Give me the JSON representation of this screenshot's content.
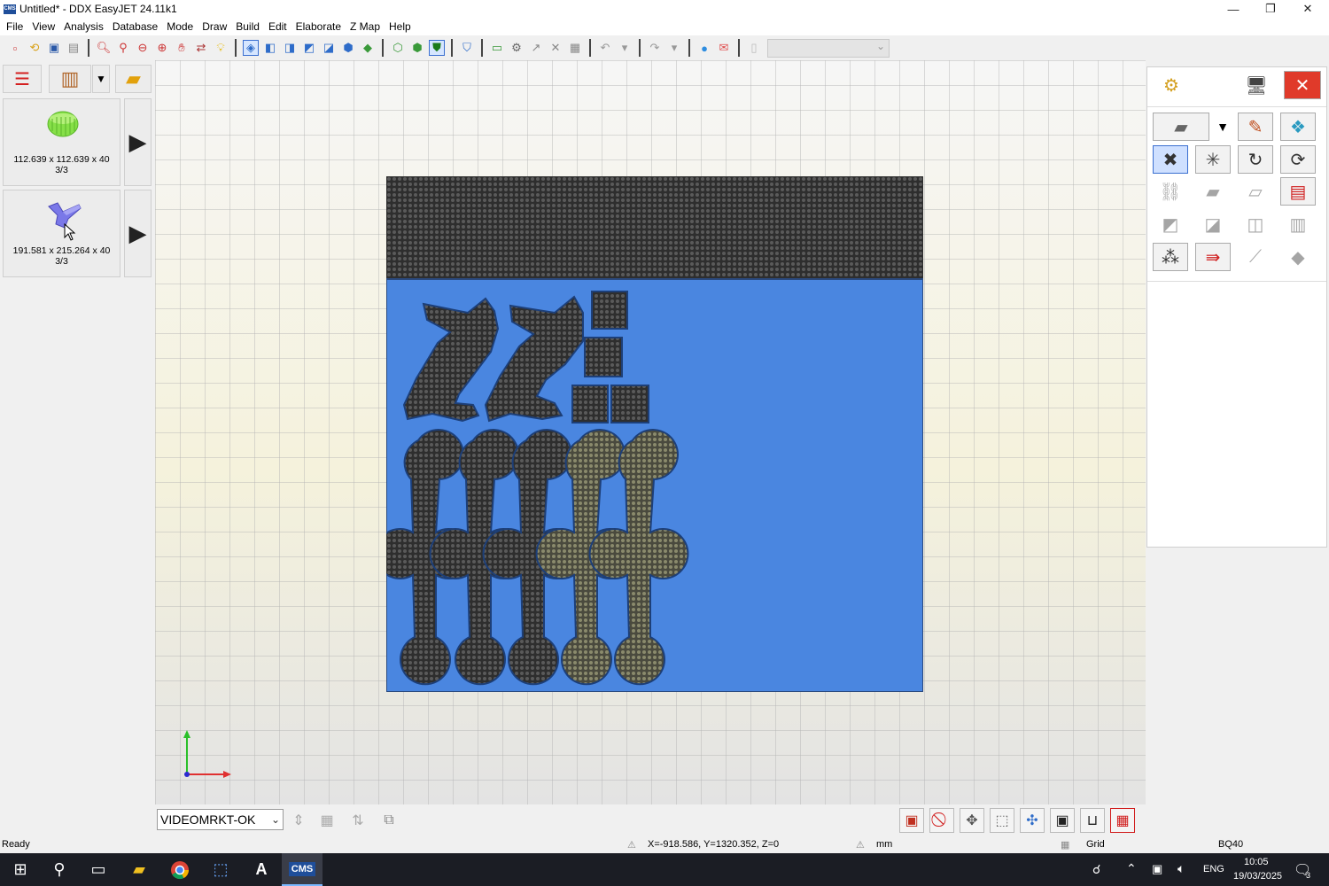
{
  "window": {
    "title": "Untitled* - DDX EasyJET 24.11k1",
    "app_icon_text": "CMS",
    "minimize": "—",
    "restore": "❐",
    "close": "✕"
  },
  "menu": [
    "File",
    "View",
    "Analysis",
    "Database",
    "Mode",
    "Draw",
    "Build",
    "Edit",
    "Elaborate",
    "Z Map",
    "Help"
  ],
  "parts": [
    {
      "size": "112.639 x 112.639 x 40",
      "qty": "3/3",
      "thumb_color": "#8ee04a"
    },
    {
      "size": "191.581 x 215.264 x 40",
      "qty": "3/3",
      "thumb_color": "#6f6fe0"
    }
  ],
  "bottom": {
    "layer_value": "VIDEOMRKT-OK"
  },
  "status": {
    "state": "Ready",
    "coords": "X=-918.586, Y=1320.352, Z=0",
    "unit": "mm",
    "grid": "Grid",
    "machine": "BQ40"
  },
  "taskbar": {
    "lang": "ENG",
    "time": "10:05",
    "date": "19/03/2025",
    "notifications": "3",
    "app_label": "CMS"
  },
  "colors": {
    "sheet_blue": "#4a86e0",
    "mesh_dark": "#3a3a3a",
    "accent_selected": "#3a6fd0"
  }
}
